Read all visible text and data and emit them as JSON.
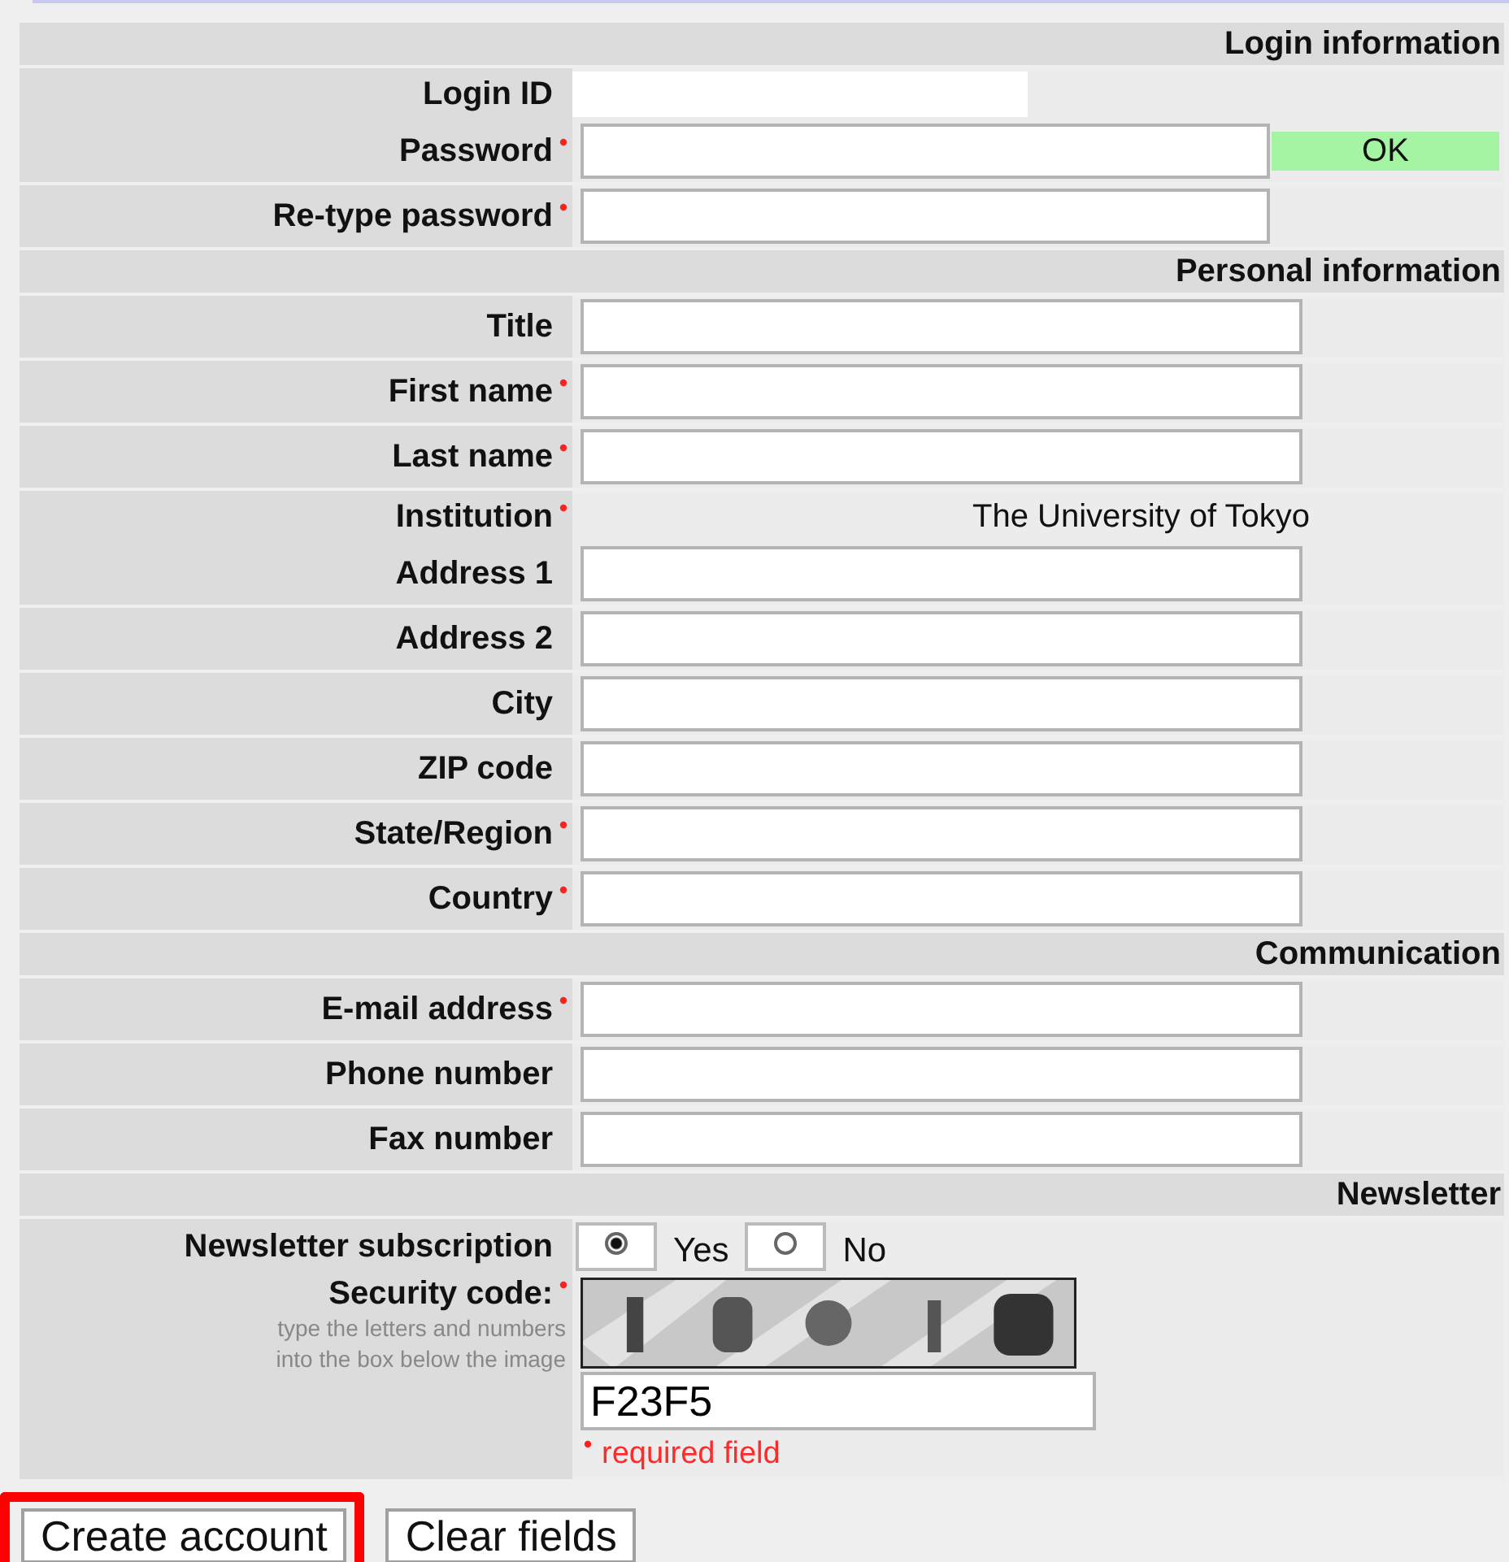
{
  "sections": [
    {
      "heading": "Login information",
      "rows": [
        {
          "kind": "text",
          "label": "Login ID",
          "required": false,
          "value": ""
        },
        {
          "kind": "short_field",
          "label": "Password",
          "required": true,
          "value": "",
          "badge": "OK"
        },
        {
          "kind": "short_field",
          "label": "Re-type password",
          "required": true,
          "value": ""
        }
      ]
    },
    {
      "heading": "Personal information",
      "rows": [
        {
          "kind": "field",
          "label": "Title",
          "required": false,
          "value": ""
        },
        {
          "kind": "field",
          "label": "First name",
          "required": true,
          "value": ""
        },
        {
          "kind": "field",
          "label": "Last name",
          "required": true,
          "value": ""
        },
        {
          "kind": "text",
          "label": "Institution",
          "required": true,
          "value": "The University of Tokyo"
        },
        {
          "kind": "field",
          "label": "Address 1",
          "required": false,
          "value": ""
        },
        {
          "kind": "field",
          "label": "Address 2",
          "required": false,
          "value": ""
        },
        {
          "kind": "field",
          "label": "City",
          "required": false,
          "value": ""
        },
        {
          "kind": "field",
          "label": "ZIP code",
          "required": false,
          "value": ""
        },
        {
          "kind": "field",
          "label": "State/Region",
          "required": true,
          "value": ""
        },
        {
          "kind": "field",
          "label": "Country",
          "required": true,
          "value": ""
        }
      ]
    },
    {
      "heading": "Communication",
      "rows": [
        {
          "kind": "field",
          "label": "E-mail address",
          "required": true,
          "value": ""
        },
        {
          "kind": "field",
          "label": "Phone number",
          "required": false,
          "value": ""
        },
        {
          "kind": "field",
          "label": "Fax number",
          "required": false,
          "value": ""
        }
      ]
    },
    {
      "heading": "Newsletter",
      "rows": [
        {
          "kind": "radio",
          "label": "Newsletter subscription",
          "required": false,
          "options": [
            {
              "label": "Yes",
              "selected": true
            },
            {
              "label": "No",
              "selected": false
            }
          ]
        },
        {
          "kind": "captcha",
          "label": "Security code:",
          "required": true,
          "hint_lines": [
            "type the letters and numbers",
            "into the box below the image"
          ],
          "value": "F23F5",
          "legend": "required field"
        }
      ]
    }
  ],
  "buttons": [
    {
      "label": "Create account",
      "highlighted": true
    },
    {
      "label": "Clear fields",
      "highlighted": false
    }
  ]
}
